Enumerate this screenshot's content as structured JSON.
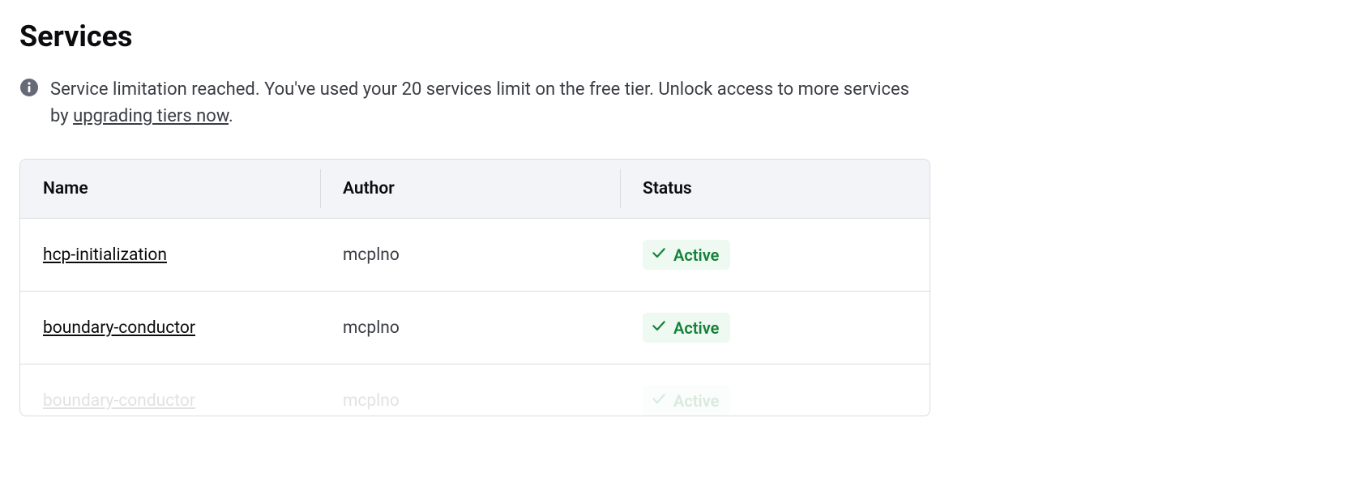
{
  "page": {
    "title": "Services"
  },
  "alert": {
    "text_before_link": "Service limitation reached. You've used your 20 services limit on the free tier. Unlock access to more services by ",
    "link_text": "upgrading tiers now",
    "text_after_link": "."
  },
  "table": {
    "headers": {
      "name": "Name",
      "author": "Author",
      "status": "Status"
    },
    "rows": [
      {
        "name": "hcp-initialization",
        "author": "mcplno",
        "status": "Active"
      },
      {
        "name": "boundary-conductor",
        "author": "mcplno",
        "status": "Active"
      },
      {
        "name": "boundary-conductor",
        "author": "mcplno",
        "status": "Active"
      }
    ]
  }
}
